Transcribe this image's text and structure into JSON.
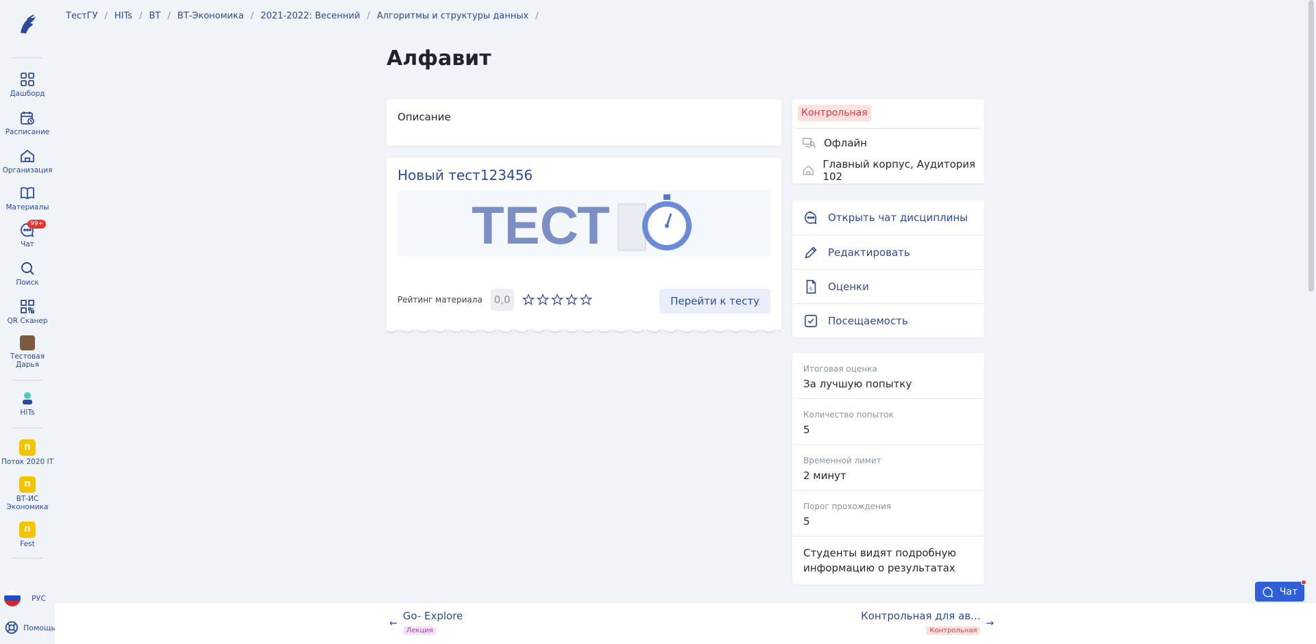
{
  "breadcrumb": [
    "ТестГУ",
    "HITs",
    "ВТ",
    "ВТ-Экономика",
    "2021-2022: Весенний",
    "Алгоритмы и структуры данных"
  ],
  "page_title": "Алфавит",
  "sidebar": {
    "items": [
      {
        "label": "Дашборд",
        "icon": "dashboard-icon"
      },
      {
        "label": "Расписание",
        "icon": "calendar-icon"
      },
      {
        "label": "Организация",
        "icon": "building-icon"
      },
      {
        "label": "Материалы",
        "icon": "book-icon"
      },
      {
        "label": "Чат",
        "icon": "chat-icon",
        "badge": "99+"
      },
      {
        "label": "Поиск",
        "icon": "search-icon"
      },
      {
        "label": "QR Сканер",
        "icon": "qr-icon"
      },
      {
        "label": "Тестовая Дарья",
        "icon": "user-avatar"
      },
      {
        "label": "HITs",
        "icon": "hits-avatar"
      },
      {
        "label": "Поток 2020 IT",
        "avatar_letter": "П"
      },
      {
        "label": "ВТ-ИС Экономика",
        "avatar_letter": "П"
      },
      {
        "label": "Fest",
        "avatar_letter": "П"
      }
    ],
    "language": "РУС",
    "help": "Помощь"
  },
  "description": {
    "label": "Описание"
  },
  "test": {
    "title": "Новый тест123456",
    "image_text": "ТЕСТ",
    "rating_label": "Рейтинг материала",
    "rating_value": "0,0",
    "stars_filled": 0,
    "stars_total": 5,
    "go_button": "Перейти к тесту"
  },
  "info": {
    "type_badge": "Контрольная",
    "format": "Офлайн",
    "location": "Главный корпус, Аудитория 102"
  },
  "actions": [
    {
      "label": "Открыть чат дисциплины",
      "icon": "chat-icon"
    },
    {
      "label": "Редактировать",
      "icon": "pencil-icon"
    },
    {
      "label": "Оценки",
      "icon": "grades-icon"
    },
    {
      "label": "Посещаемость",
      "icon": "checkbox-icon"
    }
  ],
  "meta": [
    {
      "key": "Итоговая оценка",
      "value": "За лучшую попытку"
    },
    {
      "key": "Количество попыток",
      "value": "5"
    },
    {
      "key": "Временной лимит",
      "value": "2 минут"
    },
    {
      "key": "Порог прохождения",
      "value": "5"
    },
    {
      "key": "",
      "value": "Студенты видят подробную информацию о результатах"
    }
  ],
  "footer": {
    "prev": {
      "title": "Go- Explore",
      "tag": "Лекция"
    },
    "next": {
      "title": "Контрольная для ав...",
      "tag": "Контрольная"
    }
  },
  "chat_fab": "Чат",
  "colors": {
    "accent": "#2c4a9a",
    "danger": "#e03a3a",
    "avatar": "#f5c400"
  }
}
